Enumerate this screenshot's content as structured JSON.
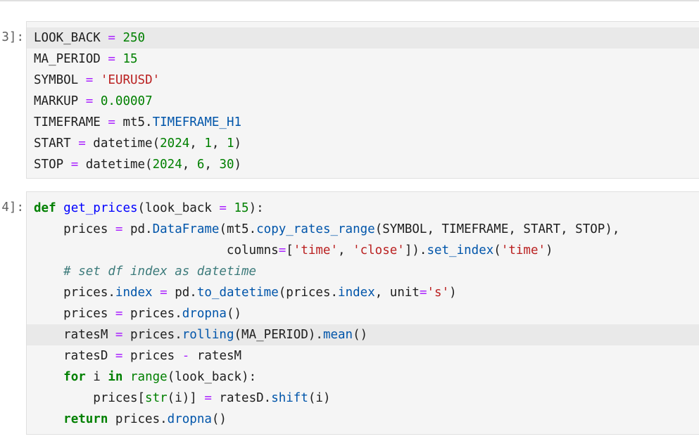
{
  "cells": [
    {
      "prompt": "3]:",
      "lines": [
        "LOOK_BACK = 250",
        "MA_PERIOD = 15",
        "SYMBOL = 'EURUSD'",
        "MARKUP = 0.00007",
        "TIMEFRAME = mt5.TIMEFRAME_H1",
        "START = datetime(2024, 1, 1)",
        "STOP = datetime(2024, 6, 30)"
      ]
    },
    {
      "prompt": "4]:",
      "lines": [
        "def get_prices(look_back = 15):",
        "    prices = pd.DataFrame(mt5.copy_rates_range(SYMBOL, TIMEFRAME, START, STOP),",
        "                          columns=['time', 'close']).set_index('time')",
        "    # set df index as datetime",
        "    prices.index = pd.to_datetime(prices.index, unit='s')",
        "    prices = prices.dropna()",
        "    ratesM = prices.rolling(MA_PERIOD).mean()",
        "    ratesD = prices - ratesM",
        "    for i in range(look_back):",
        "        prices[str(i)] = ratesD.shift(i)",
        "    return prices.dropna()"
      ]
    }
  ]
}
